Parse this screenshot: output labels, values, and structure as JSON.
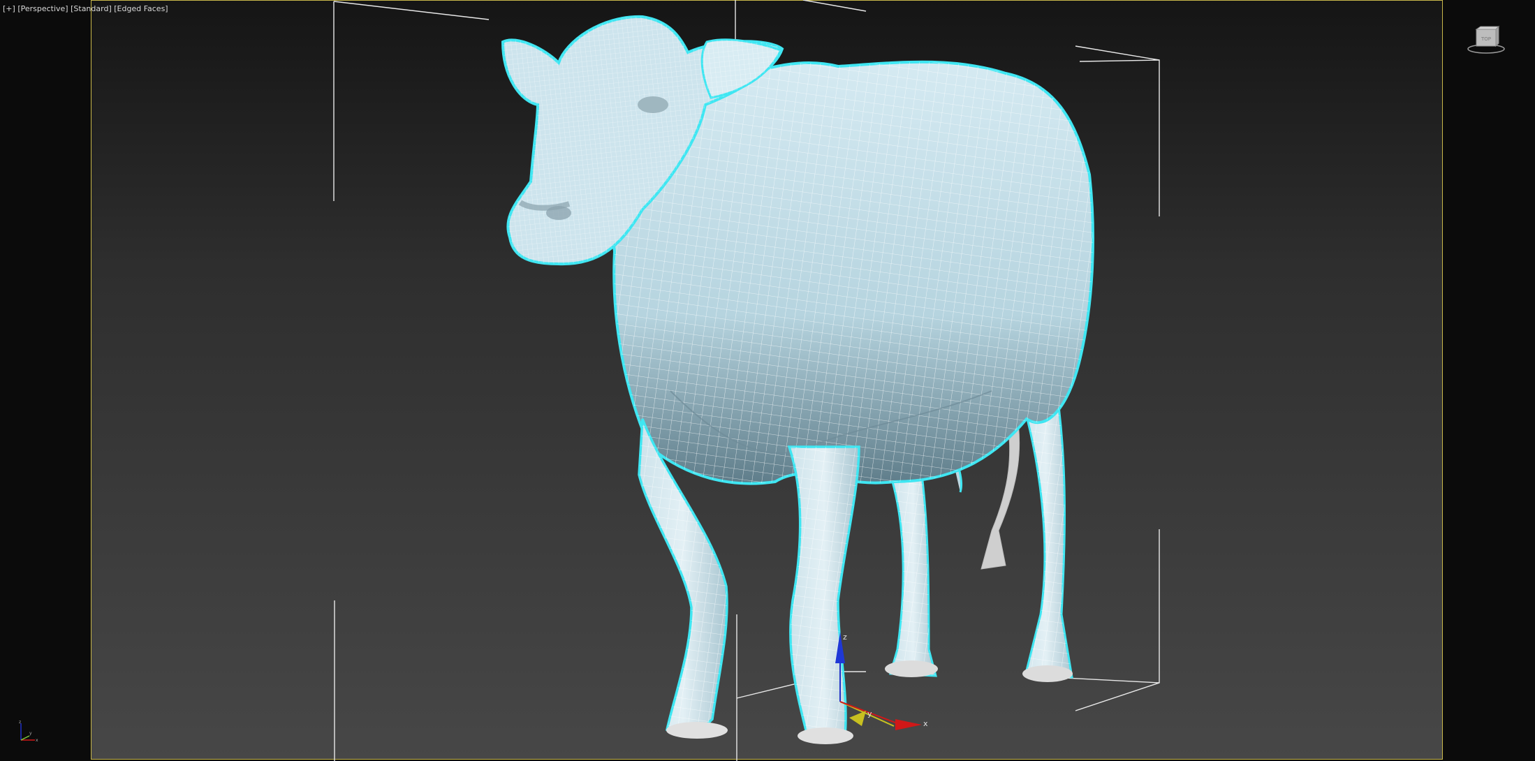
{
  "viewport": {
    "menu_plus": "[+]",
    "view_name": "[Perspective]",
    "shading_mode": "[Standard]",
    "display_mode": "[Edged Faces]"
  },
  "viewcube": {
    "icon": "viewcube-icon",
    "face_label": "TOP"
  },
  "gizmo": {
    "x_label": "x",
    "y_label": "y",
    "z_label": "z"
  },
  "mini_axis": {
    "x_label": "x",
    "y_label": "y",
    "z_label": "z"
  },
  "model": {
    "icon": "cow-mesh-icon",
    "selection_color": "#3fe6f2",
    "wire_color": "#ffffff",
    "fill_color": "#b9d9e4"
  },
  "colors": {
    "frame_border": "#c9b84a",
    "axis_x": "#d01818",
    "axis_y": "#c8c020",
    "axis_z": "#2030c8"
  }
}
